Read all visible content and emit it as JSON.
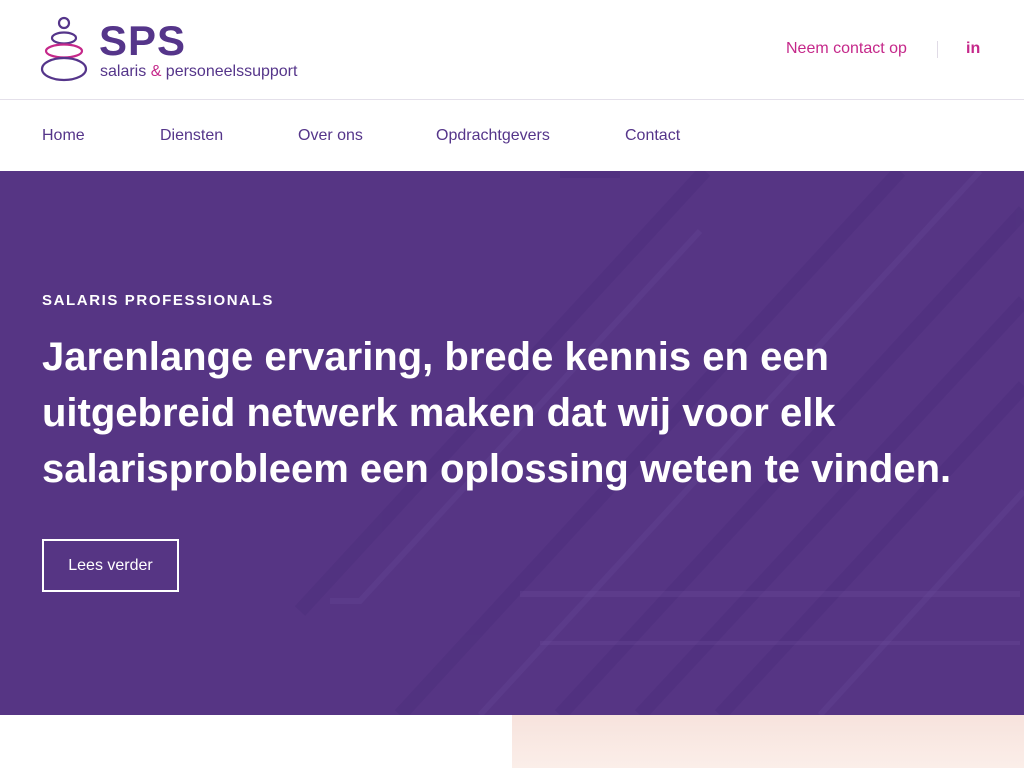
{
  "brand": {
    "name": "SPS",
    "subtitle_part1": "salaris ",
    "subtitle_amp": "&",
    "subtitle_part2": " personeelssupport"
  },
  "header": {
    "contact_label": "Neem contact op",
    "linkedin_label": "in"
  },
  "nav": {
    "items": [
      {
        "label": "Home"
      },
      {
        "label": "Diensten"
      },
      {
        "label": "Over ons"
      },
      {
        "label": "Opdrachtgevers"
      },
      {
        "label": "Contact"
      }
    ]
  },
  "hero": {
    "eyebrow": "SALARIS PROFESSIONALS",
    "headline": "Jarenlange ervaring, brede kennis en een uitgebreid netwerk maken dat wij voor elk salarisprobleem een oplossing weten te vinden.",
    "cta_label": "Lees verder"
  },
  "colors": {
    "brand_purple": "#55358a",
    "accent_magenta": "#c5288a",
    "hero_bg": "#563584",
    "peach": "#f7e3dd"
  },
  "icons": {
    "logo": "stacked-stones-icon",
    "social": "linkedin-icon"
  }
}
